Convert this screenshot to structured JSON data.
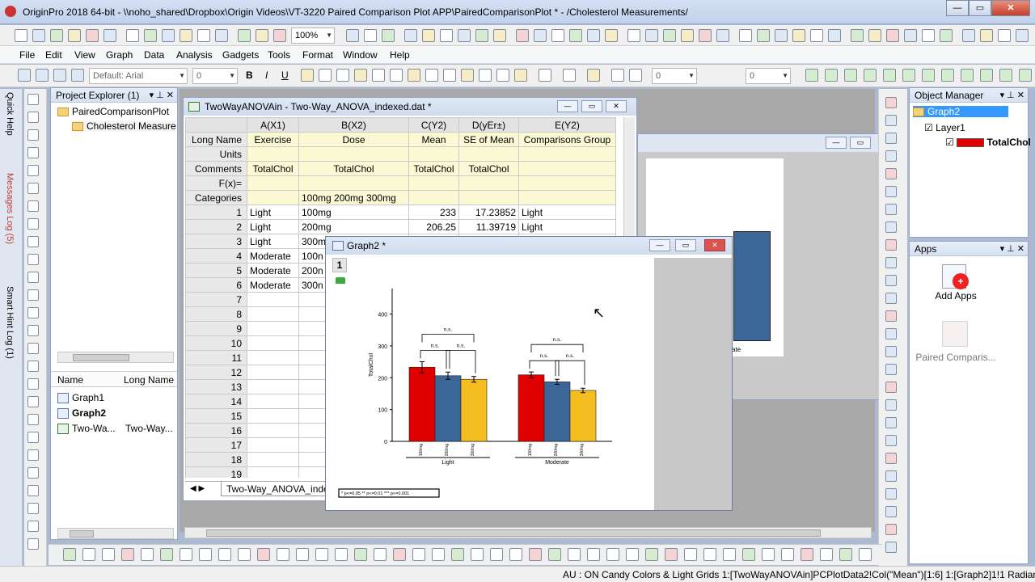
{
  "window": {
    "title": "OriginPro 2018 64-bit - \\\\noho_shared\\Dropbox\\Origin Videos\\VT-3220 Paired Comparison Plot APP\\PairedComparisonPlot * - /Cholesterol Measurements/"
  },
  "toolbar": {
    "zoom": "100%"
  },
  "menu": [
    "File",
    "Edit",
    "View",
    "Graph",
    "Data",
    "Analysis",
    "Gadgets",
    "Tools",
    "Format",
    "Window",
    "Help"
  ],
  "format_bar": {
    "font": "Default: Arial",
    "size": "0",
    "line_width": "0",
    "value2": "0"
  },
  "side_tabs": [
    "Quick Help",
    "Messages Log (5)",
    "Smart Hint Log (1)"
  ],
  "project_explorer": {
    "title": "Project Explorer (1)",
    "root": "PairedComparisonPlot",
    "folder": "Cholesterol Measure",
    "columns": [
      "Name",
      "Long Name"
    ],
    "items": [
      {
        "name": "Graph1",
        "long": ""
      },
      {
        "name": "Graph2",
        "long": ""
      },
      {
        "name": "Two-Wa...",
        "long": "Two-Way..."
      }
    ]
  },
  "worksheet": {
    "title": "TwoWayANOVAin - Two-Way_ANOVA_indexed.dat *",
    "tab": "Two-Way_ANOVA_inde",
    "col_headers": [
      "A(X1)",
      "B(X2)",
      "C(Y2)",
      "D(yEr±)",
      "E(Y2)"
    ],
    "meta_rows": [
      {
        "label": "Long Name",
        "cells": [
          "Exercise",
          "Dose",
          "Mean",
          "SE of Mean",
          "Comparisons Group"
        ]
      },
      {
        "label": "Units",
        "cells": [
          "",
          "",
          "",
          "",
          ""
        ]
      },
      {
        "label": "Comments",
        "cells": [
          "TotalChol",
          "TotalChol",
          "TotalChol",
          "TotalChol",
          ""
        ]
      },
      {
        "label": "F(x)=",
        "cells": [
          "",
          "",
          "",
          "",
          ""
        ]
      },
      {
        "label": "Categories",
        "cells": [
          "",
          "100mg 200mg 300mg",
          "",
          "",
          ""
        ]
      }
    ],
    "rows": [
      {
        "n": "1",
        "cells": [
          "Light",
          "100mg",
          "233",
          "17.23852",
          "Light"
        ]
      },
      {
        "n": "2",
        "cells": [
          "Light",
          "200mg",
          "206.25",
          "11.39719",
          "Light"
        ]
      },
      {
        "n": "3",
        "cells": [
          "Light",
          "300m",
          "",
          "",
          ""
        ]
      },
      {
        "n": "4",
        "cells": [
          "Moderate",
          "100n",
          "",
          "",
          ""
        ]
      },
      {
        "n": "5",
        "cells": [
          "Moderate",
          "200n",
          "",
          "",
          ""
        ]
      },
      {
        "n": "6",
        "cells": [
          "Moderate",
          "300n",
          "",
          "",
          ""
        ]
      },
      {
        "n": "7",
        "cells": [
          "",
          "",
          "",
          "",
          ""
        ]
      },
      {
        "n": "8",
        "cells": [
          "",
          "",
          "",
          "",
          ""
        ]
      },
      {
        "n": "9",
        "cells": [
          "",
          "",
          "",
          "",
          ""
        ]
      },
      {
        "n": "10",
        "cells": [
          "",
          "",
          "",
          "",
          ""
        ]
      },
      {
        "n": "11",
        "cells": [
          "",
          "",
          "",
          "",
          ""
        ]
      },
      {
        "n": "12",
        "cells": [
          "",
          "",
          "",
          "",
          ""
        ]
      },
      {
        "n": "13",
        "cells": [
          "",
          "",
          "",
          "",
          ""
        ]
      },
      {
        "n": "14",
        "cells": [
          "",
          "",
          "",
          "",
          ""
        ]
      },
      {
        "n": "15",
        "cells": [
          "",
          "",
          "",
          "",
          ""
        ]
      },
      {
        "n": "16",
        "cells": [
          "",
          "",
          "",
          "",
          ""
        ]
      },
      {
        "n": "17",
        "cells": [
          "",
          "",
          "",
          "",
          ""
        ]
      },
      {
        "n": "18",
        "cells": [
          "",
          "",
          "",
          "",
          ""
        ]
      },
      {
        "n": "19",
        "cells": [
          "",
          "",
          "",
          "",
          ""
        ]
      }
    ]
  },
  "graph_window": {
    "title": "Graph2 *",
    "layer_label": "1",
    "back_label": "ate"
  },
  "chart_data": {
    "type": "bar",
    "ylabel": "TotalChol",
    "ylim": [
      0,
      480
    ],
    "yticks": [
      "0",
      "100",
      "200",
      "300",
      "400"
    ],
    "groups": [
      "Light",
      "Moderate"
    ],
    "categories": [
      "100mg",
      "200mg",
      "300mg"
    ],
    "series_colors": [
      "#e00000",
      "#3a6798",
      "#f5bd1f"
    ],
    "values": [
      [
        233,
        206.25,
        195
      ],
      [
        209,
        187,
        160
      ]
    ],
    "errors": [
      [
        17.2,
        11.4,
        9
      ],
      [
        9,
        8,
        7
      ]
    ],
    "sig_label": "n.s.",
    "legend_text": "* p<=0.05   ** p<=0.01   *** p<=0.001"
  },
  "object_manager": {
    "title": "Object Manager",
    "graph": "Graph2",
    "layer": "Layer1",
    "plot": "TotalChol"
  },
  "apps": {
    "title": "Apps",
    "items": [
      "Add Apps",
      "Paired Comparis..."
    ]
  },
  "statusbar": {
    "text": "AU : ON  Candy Colors & Light Grids  1:[TwoWayANOVAin]PCPlotData2!Col(\"Mean\")[1:6]  1:[Graph2]1!1  Radian"
  }
}
